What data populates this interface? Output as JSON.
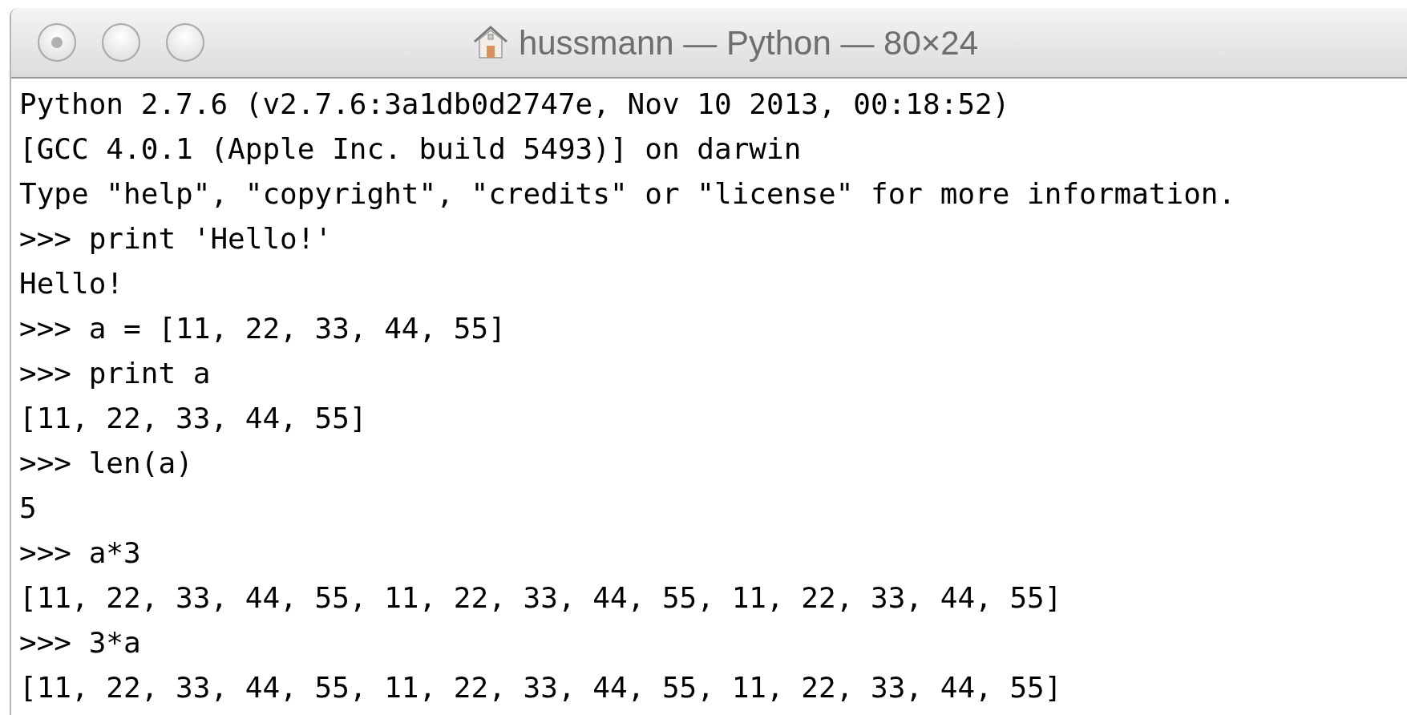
{
  "window": {
    "title": "hussmann — Python — 80×24"
  },
  "lines": [
    "Python 2.7.6 (v2.7.6:3a1db0d2747e, Nov 10 2013, 00:18:52)",
    "[GCC 4.0.1 (Apple Inc. build 5493)] on darwin",
    "Type \"help\", \"copyright\", \"credits\" or \"license\" for more information.",
    ">>> print 'Hello!'",
    "Hello!",
    ">>> a = [11, 22, 33, 44, 55]",
    ">>> print a",
    "[11, 22, 33, 44, 55]",
    ">>> len(a)",
    "5",
    ">>> a*3",
    "[11, 22, 33, 44, 55, 11, 22, 33, 44, 55, 11, 22, 33, 44, 55]",
    ">>> 3*a",
    "[11, 22, 33, 44, 55, 11, 22, 33, 44, 55, 11, 22, 33, 44, 55]"
  ]
}
